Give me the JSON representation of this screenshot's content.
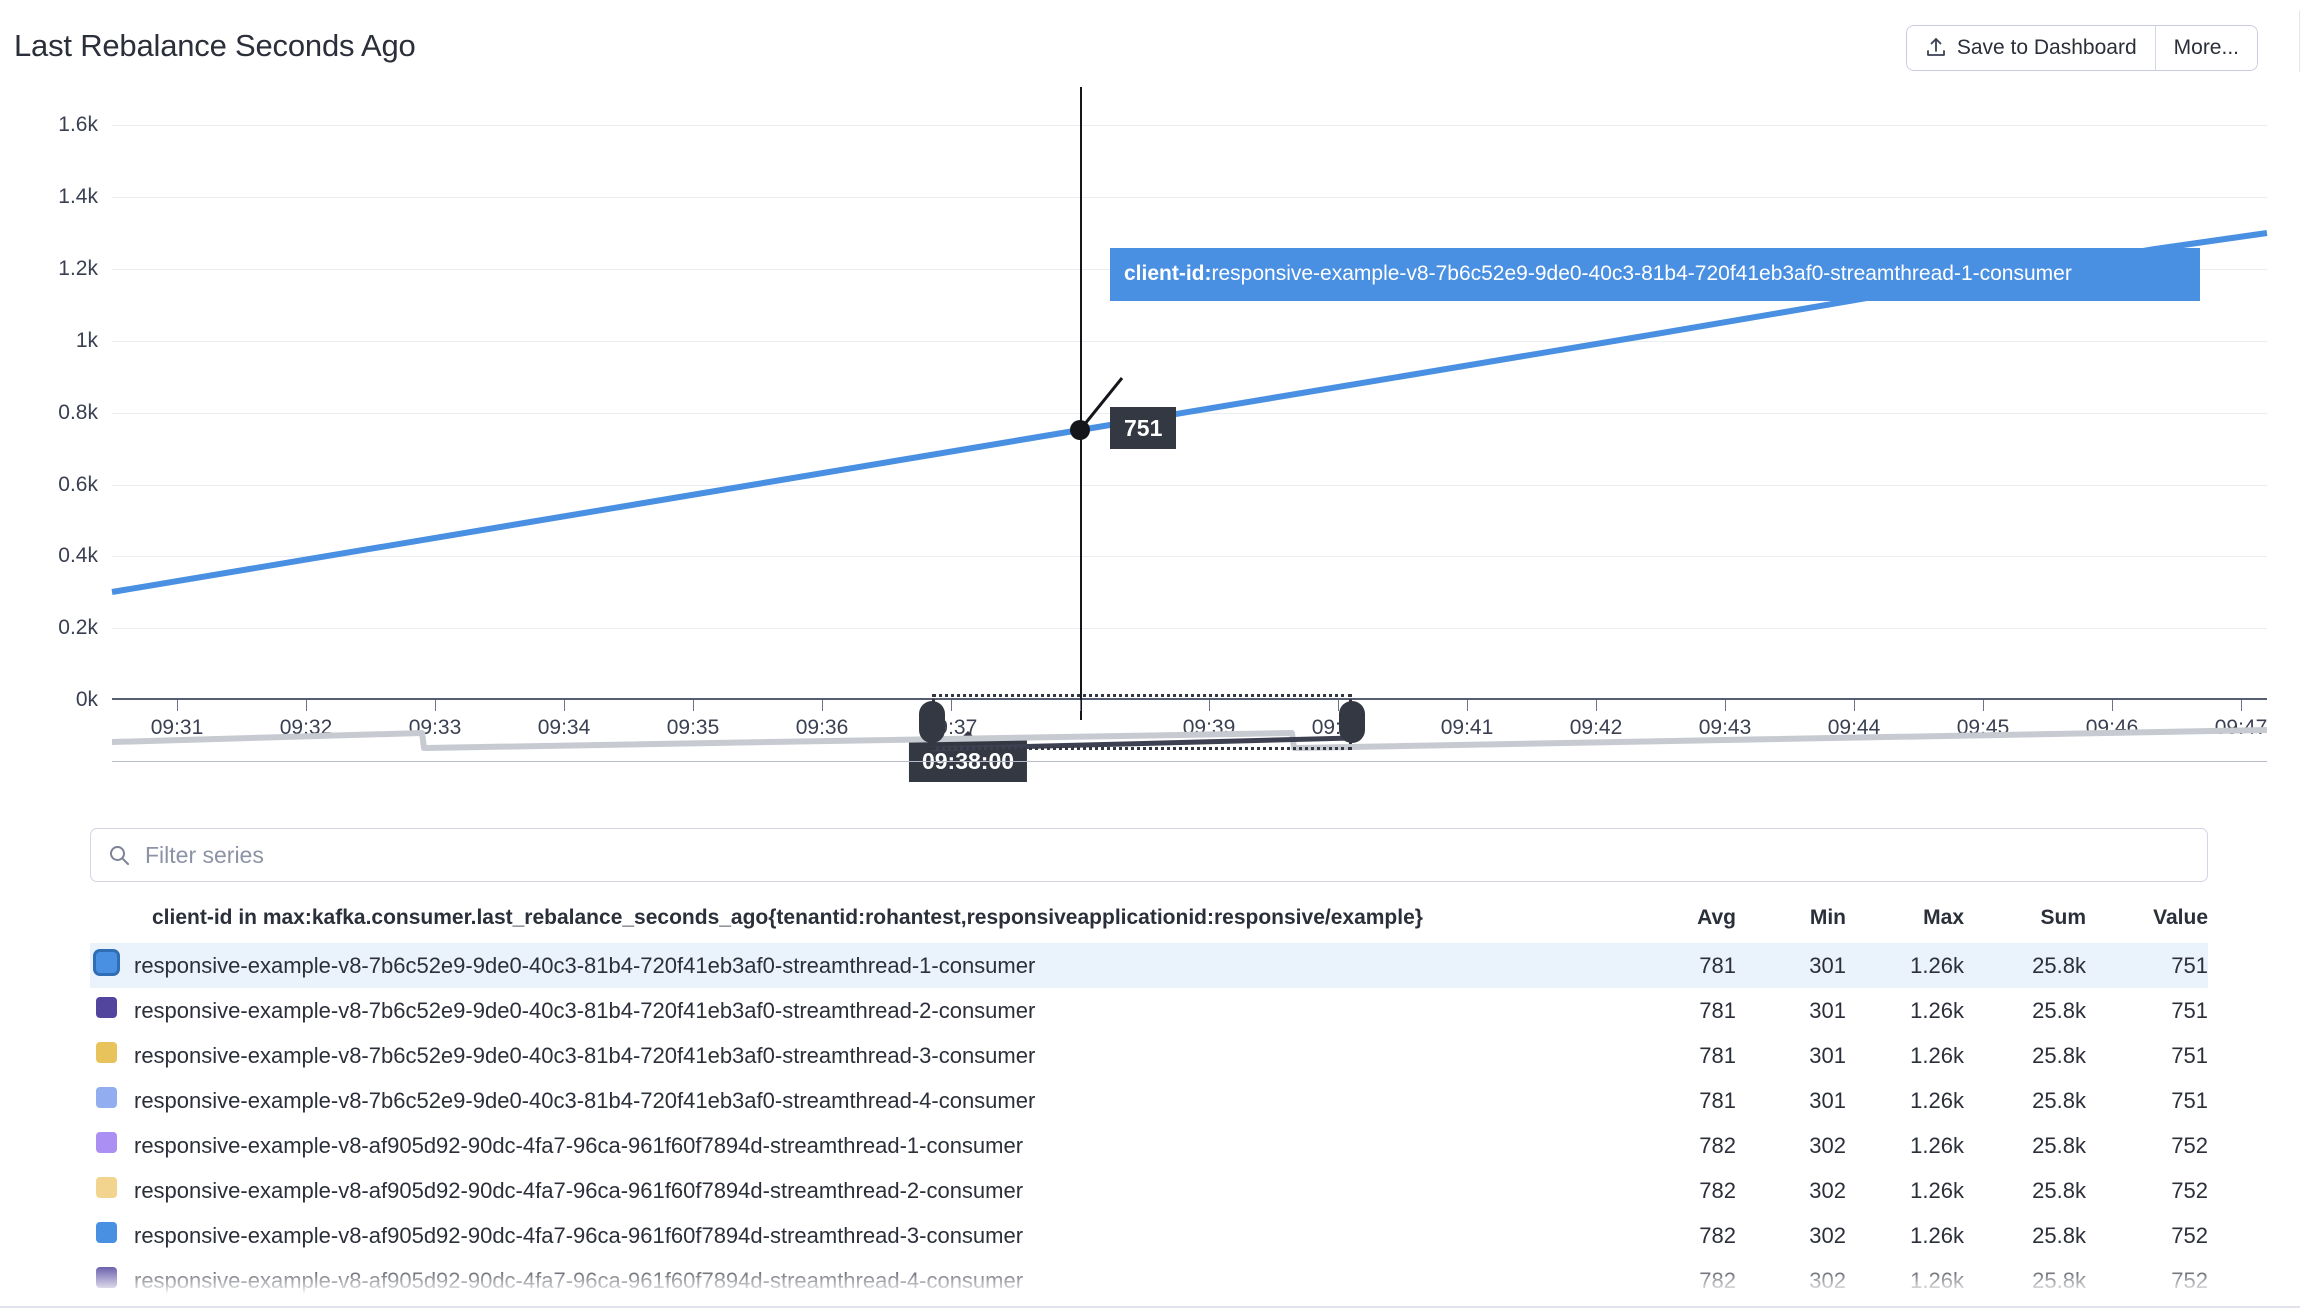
{
  "header": {
    "title": "Last Rebalance Seconds Ago",
    "save_label": "Save to Dashboard",
    "more_label": "More...",
    "upload_icon": "upload-icon"
  },
  "search": {
    "placeholder": "Filter series",
    "value": "",
    "icon": "search-icon"
  },
  "tooltip": {
    "key_label": "client-id:",
    "series_name": "responsive-example-v8-7b6c52e9-9de0-40c3-81b4-720f41eb3af0-streamthread-1-consumer",
    "value": "751",
    "time": "09:38:00"
  },
  "legend": {
    "metric_header": "client-id in max:kafka.consumer.last_rebalance_seconds_ago{tenantid:rohantest,responsiveapplicationid:responsive/example}",
    "columns": [
      "Avg",
      "Min",
      "Max",
      "Sum",
      "Value"
    ],
    "rows": [
      {
        "color": "#4a90e2",
        "selected": true,
        "name": "responsive-example-v8-7b6c52e9-9de0-40c3-81b4-720f41eb3af0-streamthread-1-consumer",
        "avg": "781",
        "min": "301",
        "max": "1.26k",
        "sum": "25.8k",
        "value": "751"
      },
      {
        "color": "#51459e",
        "selected": false,
        "name": "responsive-example-v8-7b6c52e9-9de0-40c3-81b4-720f41eb3af0-streamthread-2-consumer",
        "avg": "781",
        "min": "301",
        "max": "1.26k",
        "sum": "25.8k",
        "value": "751"
      },
      {
        "color": "#e8c25a",
        "selected": false,
        "name": "responsive-example-v8-7b6c52e9-9de0-40c3-81b4-720f41eb3af0-streamthread-3-consumer",
        "avg": "781",
        "min": "301",
        "max": "1.26k",
        "sum": "25.8k",
        "value": "751"
      },
      {
        "color": "#92aef0",
        "selected": false,
        "name": "responsive-example-v8-7b6c52e9-9de0-40c3-81b4-720f41eb3af0-streamthread-4-consumer",
        "avg": "781",
        "min": "301",
        "max": "1.26k",
        "sum": "25.8k",
        "value": "751"
      },
      {
        "color": "#ab8ff2",
        "selected": false,
        "name": "responsive-example-v8-af905d92-90dc-4fa7-96ca-961f60f7894d-streamthread-1-consumer",
        "avg": "782",
        "min": "302",
        "max": "1.26k",
        "sum": "25.8k",
        "value": "752"
      },
      {
        "color": "#f2d48e",
        "selected": false,
        "name": "responsive-example-v8-af905d92-90dc-4fa7-96ca-961f60f7894d-streamthread-2-consumer",
        "avg": "782",
        "min": "302",
        "max": "1.26k",
        "sum": "25.8k",
        "value": "752"
      },
      {
        "color": "#4a90e2",
        "selected": false,
        "name": "responsive-example-v8-af905d92-90dc-4fa7-96ca-961f60f7894d-streamthread-3-consumer",
        "avg": "782",
        "min": "302",
        "max": "1.26k",
        "sum": "25.8k",
        "value": "752"
      },
      {
        "color": "#51459e",
        "selected": false,
        "name": "responsive-example-v8-af905d92-90dc-4fa7-96ca-961f60f7894d-streamthread-4-consumer",
        "avg": "782",
        "min": "302",
        "max": "1.26k",
        "sum": "25.8k",
        "value": "752"
      }
    ]
  },
  "chart_data": {
    "type": "line",
    "title": "Last Rebalance Seconds Ago",
    "xlabel": "",
    "ylabel": "",
    "ylim": [
      0,
      1700
    ],
    "yticks": [
      0,
      200,
      400,
      600,
      800,
      1000,
      1200,
      1400,
      1600
    ],
    "ytick_labels": [
      "0k",
      "0.2k",
      "0.4k",
      "0.6k",
      "0.8k",
      "1k",
      "1.2k",
      "1.4k",
      "1.6k"
    ],
    "xticks": [
      "09:31",
      "09:32",
      "09:33",
      "09:34",
      "09:35",
      "09:36",
      "09:37",
      "09:38",
      "09:39",
      "09:40",
      "09:41",
      "09:42",
      "09:43",
      "09:44",
      "09:45",
      "09:46",
      "09:47"
    ],
    "xlim": [
      "09:30:30",
      "09:47:10"
    ],
    "grid": true,
    "legend_position": "bottom-table",
    "series": [
      {
        "name": "responsive-example-v8-7b6c52e9-9de0-40c3-81b4-720f41eb3af0-streamthread-1-consumer",
        "color": "#4a90e2",
        "x": [
          "09:30:30",
          "09:38:00",
          "09:42:20",
          "09:46:20",
          "09:47:10"
        ],
        "values": [
          301,
          751,
          1010,
          1255,
          1300
        ]
      }
    ],
    "highlight": {
      "x": "09:38:00",
      "y": 751,
      "label": "751"
    },
    "brush": {
      "from": "09:37:00",
      "to": "09:40:10"
    }
  }
}
